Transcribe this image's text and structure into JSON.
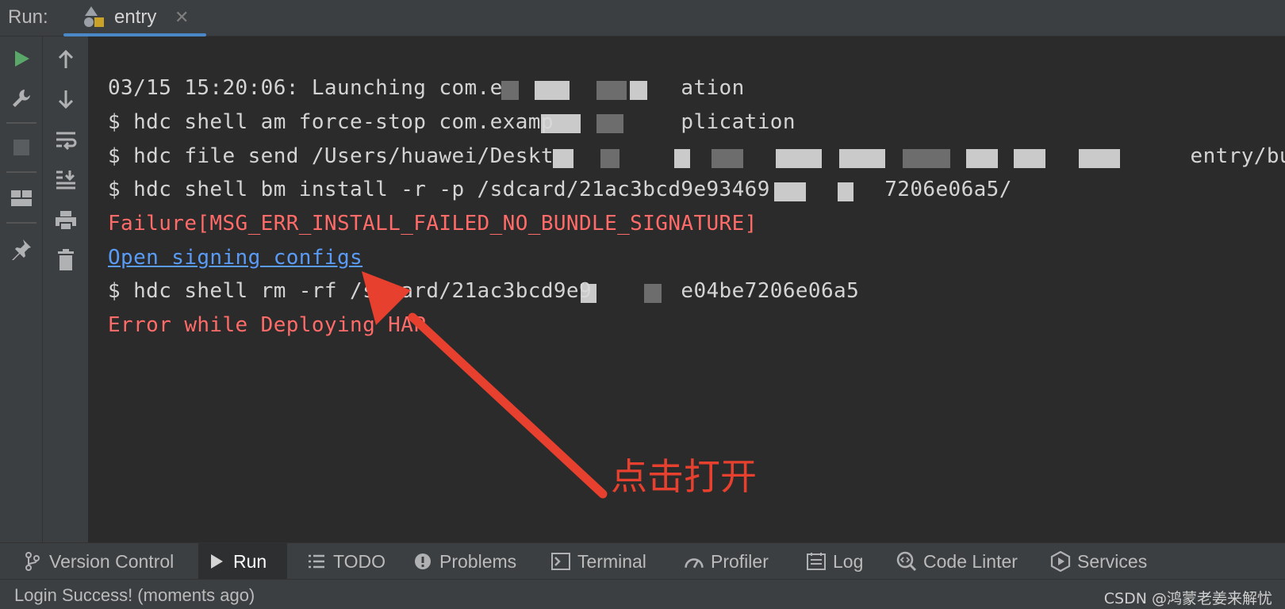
{
  "run_panel": {
    "label": "Run:",
    "tab": {
      "label": "entry",
      "close": "✕"
    }
  },
  "toolbar": {
    "left_column": [
      "run-icon",
      "wrench-icon",
      "stop-icon",
      "layout-icon",
      "pin-icon"
    ],
    "right_column": [
      "arrow-up-icon",
      "arrow-down-icon",
      "soft-wrap-icon",
      "scroll-to-end-icon",
      "print-icon",
      "trash-icon"
    ]
  },
  "console": {
    "lines": [
      {
        "text": "03/15 15:20:06: Launching com.e              ation",
        "kind": "normal"
      },
      {
        "text": "$ hdc shell am force-stop com.examp          plication",
        "kind": "normal"
      },
      {
        "text": "$ hdc file send /Users/huawei/Deskt                                                  entry/build",
        "kind": "normal"
      },
      {
        "text": "$ hdc shell bm install -r -p /sdcard/21ac3bcd9e93469         7206e06a5/",
        "kind": "normal"
      },
      {
        "text": "Failure[MSG_ERR_INSTALL_FAILED_NO_BUNDLE_SIGNATURE]",
        "kind": "error"
      },
      {
        "text": "Open signing configs",
        "kind": "link"
      },
      {
        "text": "$ hdc shell rm -rf /sdcard/21ac3bcd9e9       e04be7206e06a5",
        "kind": "normal"
      },
      {
        "text": "Error while Deploying HAP",
        "kind": "error"
      }
    ]
  },
  "annotation": {
    "text": "点击打开",
    "color": "#e8402e"
  },
  "bottom_tabs": [
    {
      "label": "Version Control",
      "icon": "branch-icon",
      "active": false
    },
    {
      "label": "Run",
      "icon": "run-icon",
      "active": true
    },
    {
      "label": "TODO",
      "icon": "list-icon",
      "active": false
    },
    {
      "label": "Problems",
      "icon": "warning-icon",
      "active": false
    },
    {
      "label": "Terminal",
      "icon": "terminal-icon",
      "active": false
    },
    {
      "label": "Profiler",
      "icon": "gauge-icon",
      "active": false
    },
    {
      "label": "Log",
      "icon": "log-icon",
      "active": false
    },
    {
      "label": "Code Linter",
      "icon": "linter-icon",
      "active": false
    },
    {
      "label": "Services",
      "icon": "services-icon",
      "active": false
    }
  ],
  "status": {
    "text": "Login Success! (moments ago)"
  },
  "watermark": "CSDN @鸿蒙老姜来解忧",
  "colors": {
    "error": "#ff6b68",
    "link": "#5a9bf5",
    "accent": "#4a88c7",
    "run_green": "#59a869"
  }
}
